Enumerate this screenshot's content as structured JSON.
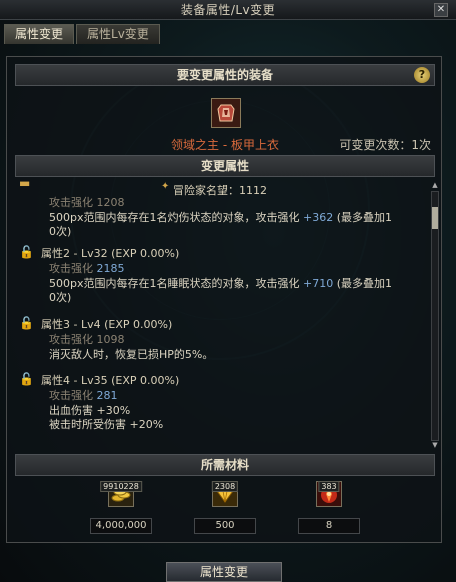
{
  "window": {
    "title": "装备属性/Lv变更"
  },
  "tabs": [
    {
      "label": "属性变更"
    },
    {
      "label": "属性Lv变更"
    }
  ],
  "equip_section": {
    "header": "要变更属性的装备",
    "equip_name": "领域之主 - 板甲上衣",
    "remaining_label": "可变更次数：1次"
  },
  "props_section": {
    "header": "变更属性",
    "reputation": "冒险家名望：1112",
    "block0": {
      "line1_label": "攻击强化",
      "line1_value": "1208",
      "line2_pre": "500px范围内每存在1名灼伤状态的对象，攻击强化 ",
      "line2_val": "+362",
      "line2_post": " (最多叠加1",
      "line3": "0次)"
    },
    "block1": {
      "title": "属性2 - Lv32 (EXP 0.00%)",
      "line1_label": "攻击强化",
      "line1_value": "2185",
      "line2_pre": "500px范围内每存在1名睡眠状态的对象，攻击强化 ",
      "line2_val": "+710",
      "line2_post": " (最多叠加1",
      "line3": "0次)"
    },
    "block2": {
      "title": "属性3 - Lv4 (EXP 0.00%)",
      "line1_label": "攻击强化",
      "line1_value": "1098",
      "line2": "消灭敌人时，恢复已损HP的5%。"
    },
    "block3": {
      "title": "属性4 - Lv35 (EXP 0.00%)",
      "line1_label": "攻击强化",
      "line1_value": "281",
      "line2": "出血伤害 +30%",
      "line3": "被击时所受伤害 +20%"
    }
  },
  "materials_section": {
    "header": "所需材料",
    "items": [
      {
        "icon": "gold-coins-icon",
        "badge": "9910228",
        "amount": "4,000,000"
      },
      {
        "icon": "diamond-icon",
        "badge": "2308",
        "amount": "500"
      },
      {
        "icon": "red-crystal-icon",
        "badge": "383",
        "amount": "8"
      }
    ]
  },
  "footer": {
    "action_label": "属性变更"
  }
}
